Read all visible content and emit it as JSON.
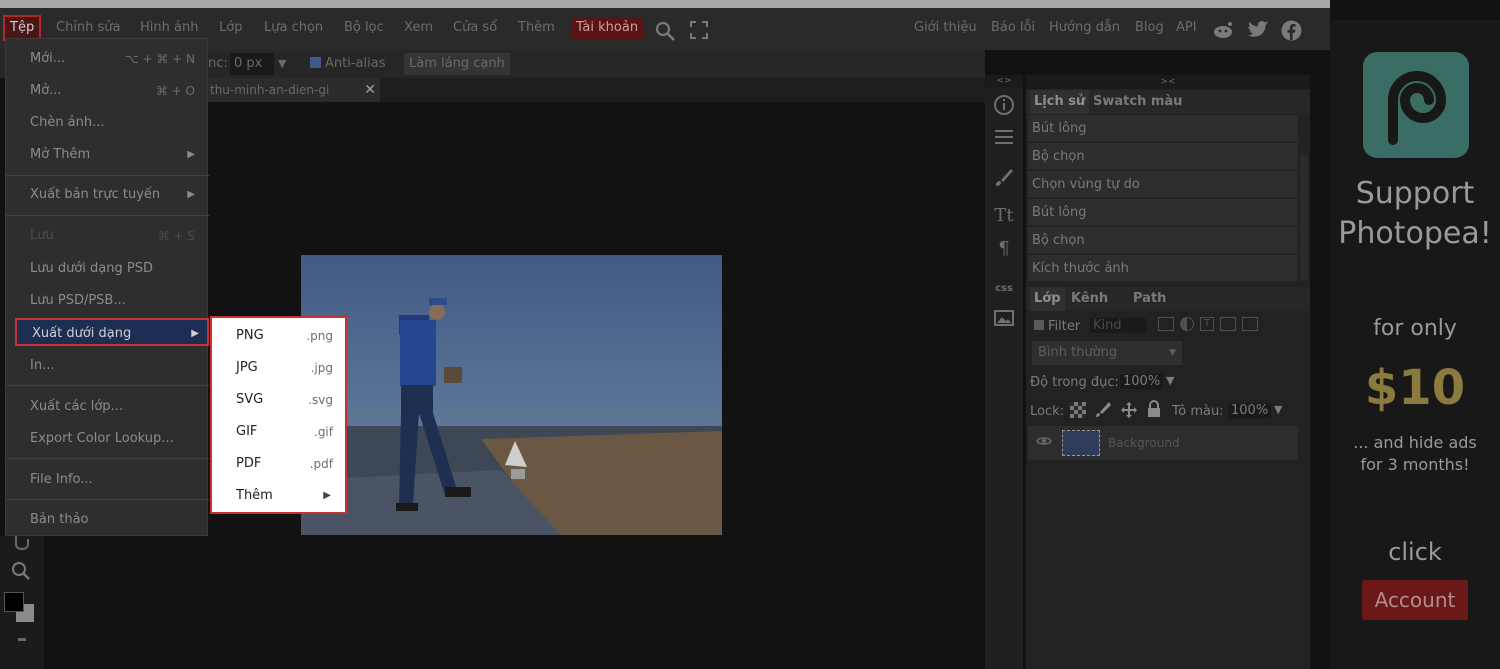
{
  "menubar": {
    "items": [
      "Tệp",
      "Chỉnh sửa",
      "Hình ảnh",
      "Lớp",
      "Lựa chọn",
      "Bộ lọc",
      "Xem",
      "Cửa sổ",
      "Thêm",
      "Tài khoản"
    ],
    "right_links": [
      "Giới thiệu",
      "Báo lỗi",
      "Hướng dẫn",
      "Blog",
      "API"
    ]
  },
  "options": {
    "feather_label": "nc:",
    "feather_value": "0 px",
    "antialias_label": "Anti-alias",
    "refine_button": "Làm láng cạnh"
  },
  "document_tab": {
    "title": "thu-minh-an-dien-gi",
    "close": "✕"
  },
  "file_menu": {
    "items": [
      {
        "label": "Mới...",
        "shortcut": "⌥ + ⌘ + N"
      },
      {
        "label": "Mở...",
        "shortcut": "⌘ + O"
      },
      {
        "label": "Chèn ảnh...",
        "shortcut": ""
      },
      {
        "label": "Mở Thêm",
        "arrow": "▶"
      },
      {
        "label": "Xuất bản trực tuyến",
        "arrow": "▶"
      },
      {
        "label": "Lưu",
        "shortcut": "⌘ + S"
      },
      {
        "label": "Lưu dưới dạng PSD",
        "shortcut": ""
      },
      {
        "label": "Lưu PSD/PSB...",
        "shortcut": ""
      },
      {
        "label": "Xuất dưới dạng",
        "arrow": "▶"
      },
      {
        "label": "In...",
        "shortcut": ""
      },
      {
        "label": "Xuất các lớp...",
        "shortcut": ""
      },
      {
        "label": "Export Color Lookup...",
        "shortcut": ""
      },
      {
        "label": "File Info...",
        "shortcut": ""
      },
      {
        "label": "Bản thảo",
        "shortcut": ""
      }
    ]
  },
  "export_submenu": {
    "items": [
      {
        "name": "PNG",
        "ext": ".png"
      },
      {
        "name": "JPG",
        "ext": ".jpg"
      },
      {
        "name": "SVG",
        "ext": ".svg"
      },
      {
        "name": "GIF",
        "ext": ".gif"
      },
      {
        "name": "PDF",
        "ext": ".pdf"
      },
      {
        "name": "Thêm",
        "arrow": "▶"
      }
    ]
  },
  "panels": {
    "top_tabs": [
      "Lịch sử",
      "Swatch màu"
    ],
    "history": [
      "Bút lông",
      "Bộ chọn",
      "Chọn vùng tự do",
      "Bút lông",
      "Bộ chọn",
      "Kích thước ảnh"
    ],
    "layer_tabs": [
      "Lớp",
      "Kênh",
      "Path"
    ],
    "filter_label": "Filter",
    "filter_kind": "Kind",
    "blend_mode": "Bình thường",
    "opacity_label": "Độ trong đục:",
    "opacity_value": "100%",
    "lock_label": "Lock:",
    "fill_label": "Tô màu:",
    "fill_value": "100%",
    "layer_name": "Background"
  },
  "ad": {
    "title_line1": "Support",
    "title_line2": "Photopea!",
    "for_only": "for only",
    "price": "$10",
    "hide_line1": "... and hide ads",
    "hide_line2": "for 3 months!",
    "click": "click",
    "button": "Account"
  },
  "colors": {
    "accent_red": "#c83232",
    "menu_highlight": "#1d2e55",
    "ad_green": "#3a6d64",
    "ad_gold": "#8b7a3e"
  }
}
